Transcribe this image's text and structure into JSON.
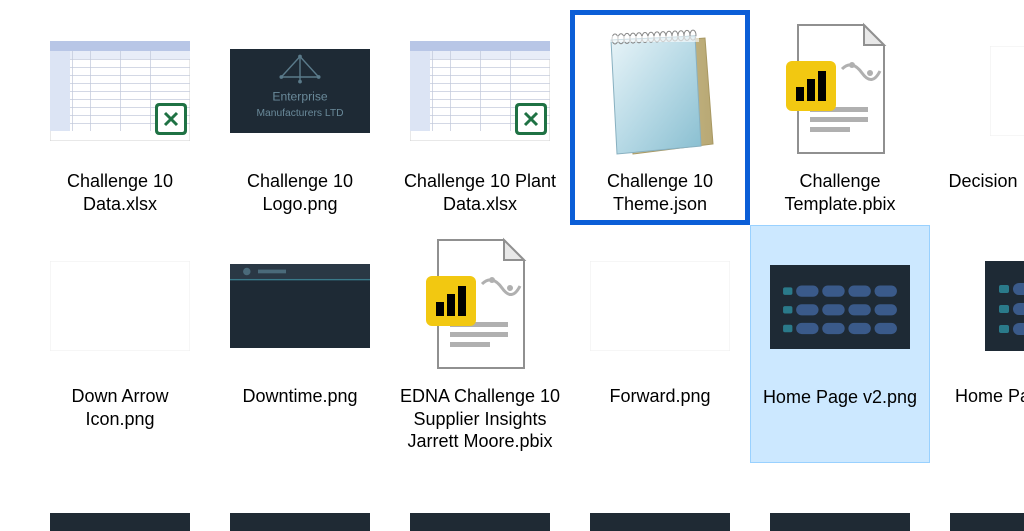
{
  "files": [
    {
      "name": "Challenge 10 Data.xlsx",
      "type": "excel-thumb"
    },
    {
      "name": "Challenge 10 Logo.png",
      "type": "logo-dark"
    },
    {
      "name": "Challenge 10 Plant Data.xlsx",
      "type": "excel-thumb"
    },
    {
      "name": "Challenge 10 Theme.json",
      "type": "notepad"
    },
    {
      "name": "Challenge Template.pbix",
      "type": "pbix"
    },
    {
      "name": "Decision Icon.png",
      "type": "blank-cut"
    },
    {
      "name": "Down Arrow Icon.png",
      "type": "blank"
    },
    {
      "name": "Downtime.png",
      "type": "dark-header"
    },
    {
      "name": "EDNA Challenge 10 Supplier Insights Jarrett Moore.pbix",
      "type": "pbix"
    },
    {
      "name": "Forward.png",
      "type": "blank"
    },
    {
      "name": "Home Page v2.png",
      "type": "dark-buttons"
    },
    {
      "name": "Home Page.png",
      "type": "dark-buttons-cut"
    }
  ],
  "selected_border_index": 3,
  "selected_highlight_index": 10
}
